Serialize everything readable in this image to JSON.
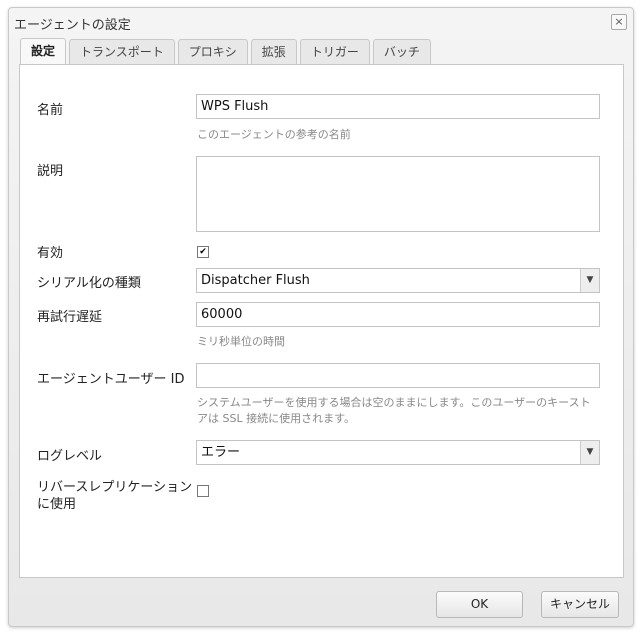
{
  "dialog": {
    "title": "エージェントの設定",
    "close": "×"
  },
  "tabs": [
    "設定",
    "トランスポート",
    "プロキシ",
    "拡張",
    "トリガー",
    "バッチ"
  ],
  "form": {
    "name_label": "名前",
    "name_value": "WPS Flush",
    "name_hint": "このエージェントの参考の名前",
    "description_label": "説明",
    "description_value": "",
    "enabled_label": "有効",
    "enabled_checked": true,
    "check_mark": "✔",
    "serialization_label": "シリアル化の種類",
    "serialization_value": "Dispatcher Flush",
    "retry_label": "再試行遅延",
    "retry_value": "60000",
    "retry_hint": "ミリ秒単位の時間",
    "userid_label": "エージェントユーザー ID",
    "userid_value": "",
    "userid_hint": "システムユーザーを使用する場合は空のままにします。このユーザーのキーストアは SSL 接続に使用されます。",
    "loglevel_label": "ログレベル",
    "loglevel_value": "エラー",
    "reverse_label": "リバースレプリケーションに使用",
    "reverse_checked": false,
    "dropdown_arrow": "▼"
  },
  "buttons": {
    "ok": "OK",
    "cancel": "キャンセル"
  }
}
